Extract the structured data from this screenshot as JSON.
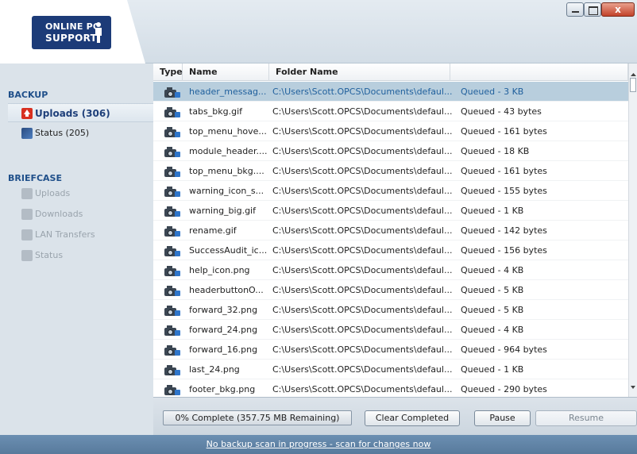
{
  "logo": {
    "line1": "ONLINE PC",
    "line2": "SUPPORT"
  },
  "window_controls": {
    "close_glyph": "x"
  },
  "sidebar": {
    "backup_title": "BACKUP",
    "uploads_label": "Uploads (306)",
    "status_label": "Status (205)",
    "briefcase_title": "BRIEFCASE",
    "briefcase_items": [
      "Uploads",
      "Downloads",
      "LAN Transfers",
      "Status"
    ]
  },
  "table": {
    "headers": {
      "type": "Type",
      "name": "Name",
      "folder": "Folder Name"
    },
    "rows": [
      {
        "name": "header_messag...",
        "folder": "C:\\Users\\Scott.OPCS\\Documents\\defaul...",
        "status": "Queued - 3 KB",
        "selected": true
      },
      {
        "name": "tabs_bkg.gif",
        "folder": "C:\\Users\\Scott.OPCS\\Documents\\defaul...",
        "status": "Queued - 43 bytes"
      },
      {
        "name": "top_menu_hove...",
        "folder": "C:\\Users\\Scott.OPCS\\Documents\\defaul...",
        "status": "Queued - 161 bytes"
      },
      {
        "name": "module_header....",
        "folder": "C:\\Users\\Scott.OPCS\\Documents\\defaul...",
        "status": "Queued - 18 KB"
      },
      {
        "name": "top_menu_bkg....",
        "folder": "C:\\Users\\Scott.OPCS\\Documents\\defaul...",
        "status": "Queued - 161 bytes"
      },
      {
        "name": "warning_icon_s...",
        "folder": "C:\\Users\\Scott.OPCS\\Documents\\defaul...",
        "status": "Queued - 155 bytes"
      },
      {
        "name": "warning_big.gif",
        "folder": "C:\\Users\\Scott.OPCS\\Documents\\defaul...",
        "status": "Queued - 1 KB"
      },
      {
        "name": "rename.gif",
        "folder": "C:\\Users\\Scott.OPCS\\Documents\\defaul...",
        "status": "Queued - 142 bytes"
      },
      {
        "name": "SuccessAudit_ic...",
        "folder": "C:\\Users\\Scott.OPCS\\Documents\\defaul...",
        "status": "Queued - 156 bytes"
      },
      {
        "name": "help_icon.png",
        "folder": "C:\\Users\\Scott.OPCS\\Documents\\defaul...",
        "status": "Queued - 4 KB"
      },
      {
        "name": "headerbuttonO...",
        "folder": "C:\\Users\\Scott.OPCS\\Documents\\defaul...",
        "status": "Queued - 5 KB"
      },
      {
        "name": "forward_32.png",
        "folder": "C:\\Users\\Scott.OPCS\\Documents\\defaul...",
        "status": "Queued - 5 KB"
      },
      {
        "name": "forward_24.png",
        "folder": "C:\\Users\\Scott.OPCS\\Documents\\defaul...",
        "status": "Queued - 4 KB"
      },
      {
        "name": "forward_16.png",
        "folder": "C:\\Users\\Scott.OPCS\\Documents\\defaul...",
        "status": "Queued - 964 bytes"
      },
      {
        "name": "last_24.png",
        "folder": "C:\\Users\\Scott.OPCS\\Documents\\defaul...",
        "status": "Queued - 1 KB"
      },
      {
        "name": "footer_bkg.png",
        "folder": "C:\\Users\\Scott.OPCS\\Documents\\defaul...",
        "status": "Queued - 290 bytes"
      }
    ]
  },
  "bottom": {
    "progress_label": "0% Complete (357.75 MB Remaining)",
    "clear_label": "Clear Completed",
    "pause_label": "Pause",
    "resume_label": "Resume"
  },
  "statusbar": {
    "scan_link": "No backup scan in progress - scan for changes now"
  },
  "colors": {
    "accent": "#1f4f8a",
    "selection": "#b8cedd",
    "statusbar": "#5f82a5",
    "upload_icon": "#d83020"
  }
}
